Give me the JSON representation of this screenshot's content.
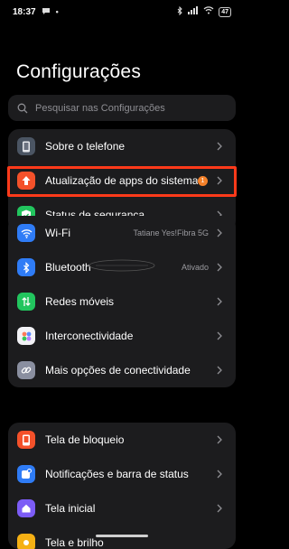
{
  "status_bar": {
    "time": "18:37",
    "battery": "47",
    "icons": [
      "message-icon",
      "dot-icon",
      "bluetooth-icon",
      "signal-icon",
      "wifi-icon",
      "battery-icon"
    ]
  },
  "header": {
    "title": "Configurações"
  },
  "search": {
    "placeholder": "Pesquisar nas Configurações"
  },
  "groups": [
    {
      "items": [
        {
          "label": "Sobre o telefone",
          "icon": "phone-icon",
          "color": "#6b7280"
        },
        {
          "label": "Atualização de apps do sistema",
          "icon": "update-arrow-icon",
          "color": "#f4512a",
          "badge": "1",
          "highlighted": true
        },
        {
          "label": "Status de segurança",
          "icon": "shield-check-icon",
          "color": "#22c55e"
        }
      ]
    },
    {
      "items": [
        {
          "label": "Wi-Fi",
          "icon": "wifi-icon",
          "color": "#2f7cf6",
          "value": "Tatiane Yes!Fibra 5G"
        },
        {
          "label": "Bluetooth",
          "icon": "bluetooth-icon",
          "color": "#2f7cf6",
          "value": "Ativado"
        },
        {
          "label": "Redes móveis",
          "icon": "mobile-data-icon",
          "color": "#22c55e"
        },
        {
          "label": "Interconectividade",
          "icon": "interconnect-icon",
          "color": "#e8e8ee"
        },
        {
          "label": "Mais opções de conectividade",
          "icon": "link-icon",
          "color": "#8a8fa0"
        }
      ]
    },
    {
      "items": [
        {
          "label": "Tela de bloqueio",
          "icon": "lock-screen-icon",
          "color": "#f4512a"
        },
        {
          "label": "Notificações e barra de status",
          "icon": "notification-icon",
          "color": "#2f7cf6"
        },
        {
          "label": "Tela inicial",
          "icon": "home-icon",
          "color": "#7c5cf6"
        },
        {
          "label": "Tela e brilho",
          "icon": "brightness-icon",
          "color": "#f5b014"
        }
      ]
    }
  ]
}
